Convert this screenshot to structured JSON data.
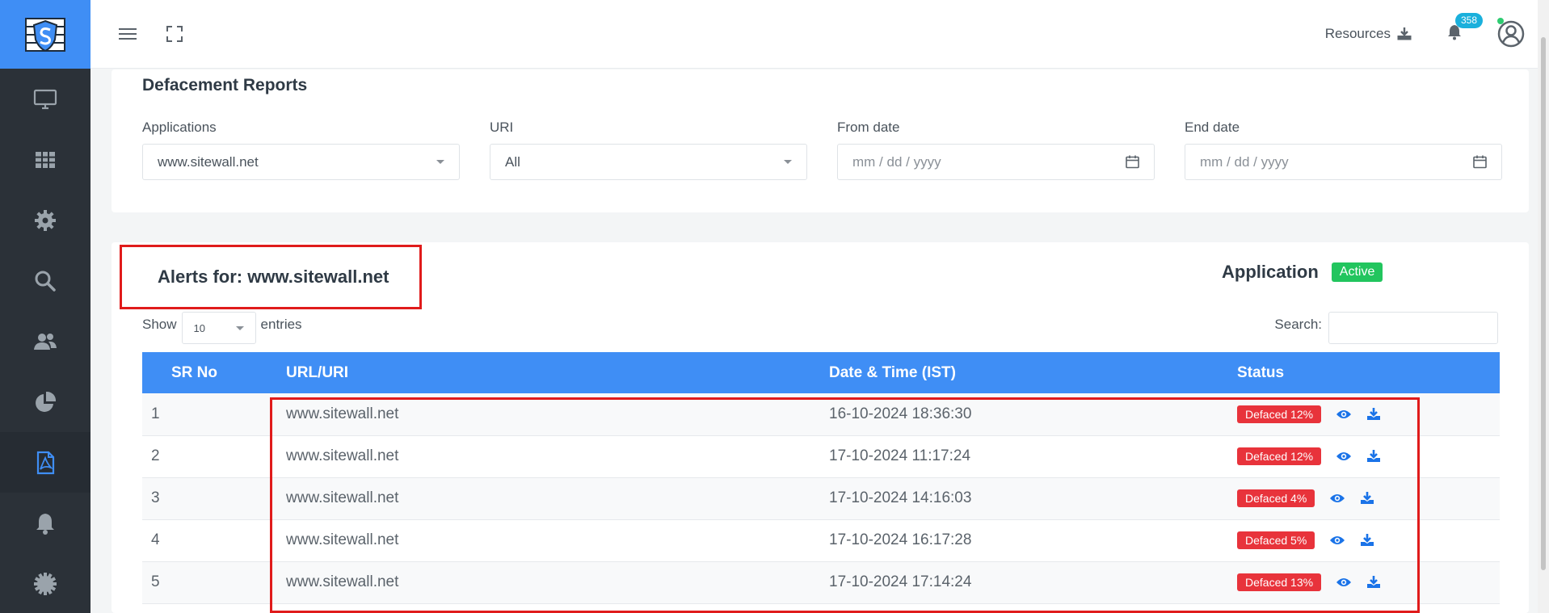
{
  "colors": {
    "accent": "#3f8ef5",
    "sidebar": "#2b3138",
    "danger": "#e8333b",
    "success": "#22c55e",
    "highlight": "#e01b1b",
    "notify": "#1ab0dc"
  },
  "sidebar": {
    "logo": "firewall-shield-logo",
    "items": [
      {
        "icon": "monitor-icon"
      },
      {
        "icon": "grid-icon"
      },
      {
        "icon": "gear-icon"
      },
      {
        "icon": "search-icon"
      },
      {
        "icon": "users-icon"
      },
      {
        "icon": "pie-chart-icon"
      },
      {
        "icon": "pdf-file-icon",
        "active": true
      },
      {
        "icon": "bell-icon"
      },
      {
        "icon": "cog-badge-icon"
      }
    ]
  },
  "topbar": {
    "menu_icon": "hamburger-icon",
    "fullscreen_icon": "fullscreen-icon",
    "resources_label": "Resources",
    "notification_count": "358"
  },
  "filters": {
    "title": "Defacement Reports",
    "applications": {
      "label": "Applications",
      "value": "www.sitewall.net"
    },
    "uri": {
      "label": "URI",
      "value": "All"
    },
    "from_date": {
      "label": "From date",
      "placeholder": "mm / dd / yyyy"
    },
    "end_date": {
      "label": "End date",
      "placeholder": "mm / dd / yyyy"
    }
  },
  "alerts": {
    "title": "Alerts for: www.sitewall.net",
    "application_label": "Application",
    "application_status": "Active",
    "show_label": "Show",
    "entries_value": "10",
    "entries_label": "entries",
    "search_label": "Search:",
    "columns": [
      "SR No",
      "URL/URI",
      "Date & Time (IST)",
      "Status"
    ],
    "rows": [
      {
        "sr": "1",
        "url": "www.sitewall.net",
        "datetime": "16-10-2024 18:36:30",
        "status": "Defaced 12%"
      },
      {
        "sr": "2",
        "url": "www.sitewall.net",
        "datetime": "17-10-2024 11:17:24",
        "status": "Defaced 12%"
      },
      {
        "sr": "3",
        "url": "www.sitewall.net",
        "datetime": "17-10-2024 14:16:03",
        "status": "Defaced 4%"
      },
      {
        "sr": "4",
        "url": "www.sitewall.net",
        "datetime": "17-10-2024 16:17:28",
        "status": "Defaced 5%"
      },
      {
        "sr": "5",
        "url": "www.sitewall.net",
        "datetime": "17-10-2024 17:14:24",
        "status": "Defaced 13%"
      }
    ]
  }
}
